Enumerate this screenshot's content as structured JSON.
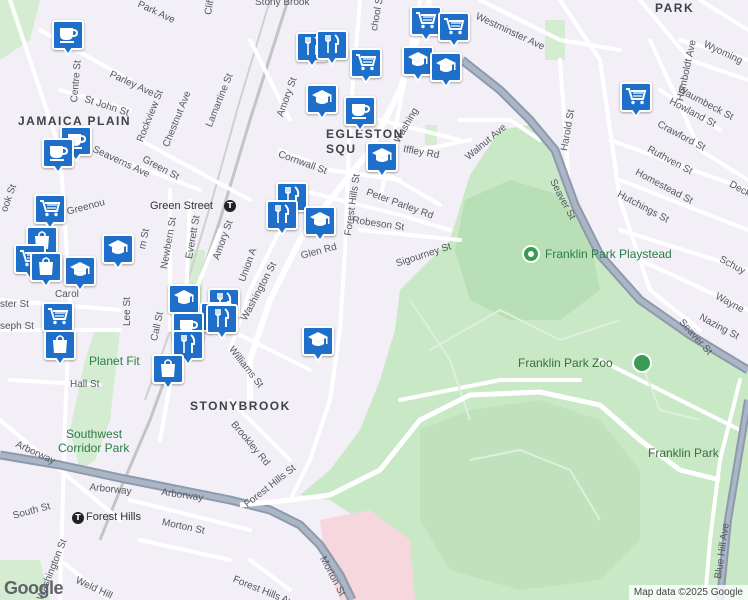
{
  "map": {
    "colors": {
      "land": "#f2eff6",
      "park": "#c8e8c6",
      "park_light": "#d8eed5",
      "golf": "#b7deb5",
      "road": "#ffffff",
      "highway": "#8e99ab",
      "highway_fill": "#aab5c6",
      "rail": "#b8b8b8",
      "pin": "#1d6fc9",
      "pink_area": "#f6d7de"
    },
    "neighborhoods": {
      "jamaica_plain": "JAMAICA PLAIN",
      "stonybrook": "STONYBROOK",
      "egleston": "EGLESTON",
      "square": "SQU",
      "park_top": "PARK"
    },
    "pois": {
      "playstead": "Franklin Park Playstead",
      "zoo": "Franklin Park Zoo",
      "franklin_park": "Franklin Park",
      "southwest_corridor_1": "Southwest",
      "southwest_corridor_2": "Corridor Park",
      "planet_fitness": "Planet Fit",
      "green_street": "Green Street",
      "forest_hills_station": "Forest Hills"
    },
    "streets": {
      "lamartine": "Lamartine St",
      "amory": "Amory St",
      "amory2": "Amory St",
      "cornwall": "Cornwall St",
      "forest_hills_st": "Forest Hills St",
      "forest_hills_st2": "Forest Hills St",
      "peter_parley": "Peter Parley Rd",
      "robeson": "Robeson St",
      "sigourney": "Sigourney St",
      "walnut": "Walnut Ave",
      "harold": "Harold St",
      "westminster": "Westminster Ave",
      "seaver": "Seaver St",
      "seaver2": "Seaver St",
      "humboldt": "Humboldt Ave",
      "wyoming": "Wyoming",
      "waumbeck": "Waumbeck St",
      "howland": "Howland St",
      "crawford": "Crawford St",
      "ruthven": "Ruthven St",
      "homestead": "Homestead St",
      "hutchings": "Hutchings St",
      "schuyler": "Schuy",
      "wayne": "Wayne",
      "nazing": "Nazing St",
      "decker": "Decke",
      "iffley": "Iffley Rd",
      "glen": "Glen Rd",
      "washington": "Washington St",
      "washington_top": "Washing",
      "washington_sw": "Washington St",
      "union": "Union A",
      "williams": "Williams St",
      "brookley": "Brookley Rd",
      "arborway": "Arborway",
      "arborway2": "Arborway",
      "arborway3": "Arborway",
      "south": "South St",
      "morton": "Morton St",
      "morton2": "Morton St",
      "blue_hill": "Blue Hill Ave",
      "hall": "Hall St",
      "lee": "Lee St",
      "call": "Call St",
      "everett": "Everett St",
      "newbern": "Newbern St",
      "parley": "Parley Ave",
      "st_john": "St John St",
      "rockview": "Rockview St",
      "chestnut": "Chestnut Ave",
      "seaverns": "Seaverns Ave",
      "green_st": "Green St",
      "centre": "Centre St",
      "weld_hill": "Weld Hill",
      "forest_hills_ave": "Forest Hills Ave",
      "school": "chool St",
      "park_ave": "Park Ave",
      "cliff": "Cliff",
      "stony_brook_top": "Stony Brook",
      "greenough": "Greenou",
      "carolina": "Carol",
      "joseph": "seph St",
      "chester": "ster St",
      "brook": "ook St",
      "washington_left": "ashington St",
      "ave_br": "Ave",
      "m_st": "m St"
    },
    "attribution": "Map data ©2025 Google",
    "logo": "Google"
  }
}
